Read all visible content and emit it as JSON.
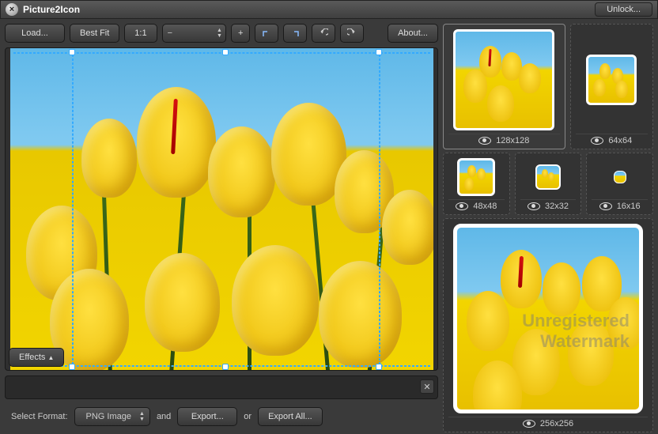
{
  "titlebar": {
    "title": "Picture2Icon",
    "unlock": "Unlock..."
  },
  "toolbar": {
    "load": "Load...",
    "bestfit": "Best Fit",
    "onetoone": "1:1",
    "about": "About...",
    "effects": "Effects"
  },
  "footer": {
    "selectFormat": "Select Format:",
    "format": "PNG Image",
    "and": "and",
    "export": "Export...",
    "or": "or",
    "exportAll": "Export All..."
  },
  "previews": {
    "p128": "128x128",
    "p64": "64x64",
    "p48": "48x48",
    "p32": "32x32",
    "p16": "16x16",
    "p256": "256x256"
  },
  "watermark": {
    "line1": "Unregistered",
    "line2": "Watermark"
  }
}
